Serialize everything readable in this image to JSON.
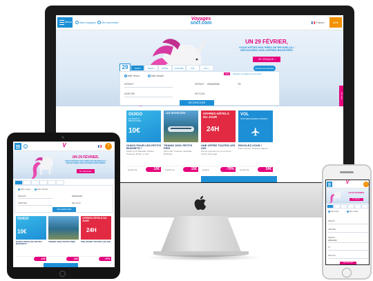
{
  "site": {
    "menu_label": "Menu",
    "nav_links": [
      "Mes voyages",
      "Me connecter"
    ],
    "logo_line1": "Voyages",
    "logo_line2": "sncf.com",
    "country": "France",
    "aide_label": "Aide"
  },
  "hero": {
    "title": "UN 29 FÉVRIER,",
    "subtitle_lines": [
      "VOUS N'ÊTES PAS PRÈS DE REVOIR ÇA !",
      "DÉCOUVREZ NOS OFFRES BOOSTÉES"
    ],
    "button_label": "JE CRAQUE !",
    "date_badge_day": "29",
    "date_badge_label": "FÉV"
  },
  "search": {
    "tabs": [
      "TRAIN",
      "TRAIN + HÔTEL",
      "HÔTEL",
      "VOITURE",
      "VOL",
      "VOL + HÔTEL"
    ],
    "trip_types": [
      "Aller retour",
      "Aller simple"
    ],
    "option_badge": "-50%",
    "option_text": "Achetez vos places sur ce train",
    "side_btn": "Recherche avancée",
    "depart_label": "DÉPART",
    "depart_value": "29/02/2016",
    "arrivee_label": "ARRIVÉE",
    "retour_label": "RETOUR",
    "time_value": "7H",
    "submit_label": "RECHERCHER",
    "side_tab": "Vos avis"
  },
  "cards": [
    {
      "img_title": "OUIGO",
      "img_sub": "LE TRAIN À PETITS PRIX",
      "img_big": "10€",
      "caption": "OUIGO POUR LES PETITS BUDGETS !",
      "text": "Partez pour Marseille, Nantes, Toulouse, Montp. et plus",
      "price_from": "à partir de",
      "price": "10€"
    },
    {
      "img_title": "LES INTERCITÉS",
      "img_sub": "",
      "img_big": "",
      "caption": "TRAINS 100% PETITS PRIX",
      "text": "Paris-Lille, Toulouse, Marseille, Bordeaux",
      "price_from": "à partir de",
      "price": "15€"
    },
    {
      "img_title": "OFFRES HÔTELS DU JOUR",
      "img_sub": "",
      "img_big": "24H",
      "caption": "UNE OFFRE TOUTES LES 24H",
      "text": "Pas de promotion en ce moment, suivez cette page",
      "price_from": "jusqu'à",
      "price": "-70%"
    },
    {
      "img_title": "VOL",
      "img_sub": "NOS MEILLEURES OFFRES",
      "img_big": "",
      "caption": "ENVOLEZ-VOUS !",
      "text": "Paris, Vienne, Toulouse, Ajaccio",
      "price_from": "à partir de",
      "price": "59€"
    }
  ],
  "colors": {
    "brand_blue": "#1d8fd6",
    "brand_pink": "#e5007d",
    "aide_orange": "#f39200",
    "hotel_red": "#e22a43"
  },
  "icons": [
    "apple-logo-icon",
    "menu-icon",
    "user-icon",
    "unicorn-illustration",
    "plane-icon",
    "train-icon"
  ]
}
